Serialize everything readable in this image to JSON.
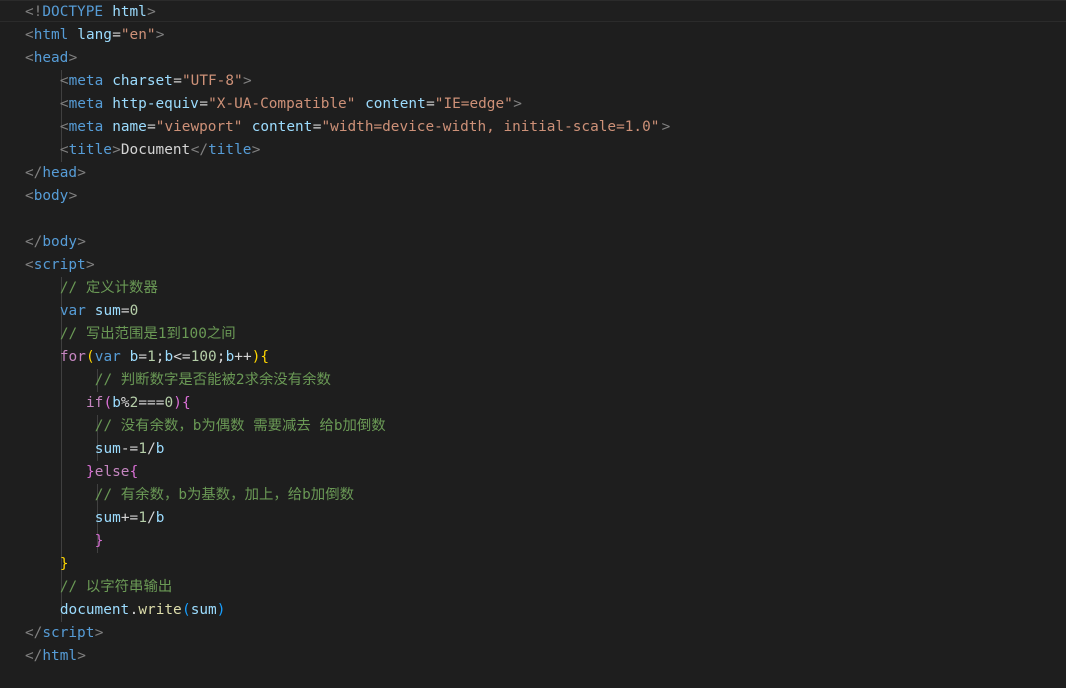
{
  "editor": {
    "language": "html",
    "theme": "dark",
    "lines": [
      [
        [
          "<!",
          "punc"
        ],
        [
          "DOCTYPE",
          "tag"
        ],
        [
          " ",
          "plain"
        ],
        [
          "html",
          "attr"
        ],
        [
          ">",
          "punc"
        ]
      ],
      [
        [
          "<",
          "punc"
        ],
        [
          "html",
          "tag"
        ],
        [
          " ",
          "plain"
        ],
        [
          "lang",
          "attr"
        ],
        [
          "=",
          "plain"
        ],
        [
          "\"en\"",
          "str"
        ],
        [
          ">",
          "punc"
        ]
      ],
      [
        [
          "<",
          "punc"
        ],
        [
          "head",
          "tag"
        ],
        [
          ">",
          "punc"
        ]
      ],
      [
        [
          "    ",
          "plain"
        ],
        [
          "<",
          "punc"
        ],
        [
          "meta",
          "tag"
        ],
        [
          " ",
          "plain"
        ],
        [
          "charset",
          "attr"
        ],
        [
          "=",
          "plain"
        ],
        [
          "\"UTF-8\"",
          "str"
        ],
        [
          ">",
          "punc"
        ]
      ],
      [
        [
          "    ",
          "plain"
        ],
        [
          "<",
          "punc"
        ],
        [
          "meta",
          "tag"
        ],
        [
          " ",
          "plain"
        ],
        [
          "http-equiv",
          "attr"
        ],
        [
          "=",
          "plain"
        ],
        [
          "\"X-UA-Compatible\"",
          "str"
        ],
        [
          " ",
          "plain"
        ],
        [
          "content",
          "attr"
        ],
        [
          "=",
          "plain"
        ],
        [
          "\"IE=edge\"",
          "str"
        ],
        [
          ">",
          "punc"
        ]
      ],
      [
        [
          "    ",
          "plain"
        ],
        [
          "<",
          "punc"
        ],
        [
          "meta",
          "tag"
        ],
        [
          " ",
          "plain"
        ],
        [
          "name",
          "attr"
        ],
        [
          "=",
          "plain"
        ],
        [
          "\"viewport\"",
          "str"
        ],
        [
          " ",
          "plain"
        ],
        [
          "content",
          "attr"
        ],
        [
          "=",
          "plain"
        ],
        [
          "\"width=device-width, initial-scale=1.0\"",
          "str"
        ],
        [
          ">",
          "punc"
        ]
      ],
      [
        [
          "    ",
          "plain"
        ],
        [
          "<",
          "punc"
        ],
        [
          "title",
          "tag"
        ],
        [
          ">",
          "punc"
        ],
        [
          "Document",
          "plain"
        ],
        [
          "</",
          "punc"
        ],
        [
          "title",
          "tag"
        ],
        [
          ">",
          "punc"
        ]
      ],
      [
        [
          "</",
          "punc"
        ],
        [
          "head",
          "tag"
        ],
        [
          ">",
          "punc"
        ]
      ],
      [
        [
          "<",
          "punc"
        ],
        [
          "body",
          "tag"
        ],
        [
          ">",
          "punc"
        ]
      ],
      [],
      [
        [
          "</",
          "punc"
        ],
        [
          "body",
          "tag"
        ],
        [
          ">",
          "punc"
        ]
      ],
      [
        [
          "<",
          "punc"
        ],
        [
          "script",
          "tag"
        ],
        [
          ">",
          "punc"
        ]
      ],
      [
        [
          "    ",
          "plain"
        ],
        [
          "// 定义计数器",
          "cmt"
        ]
      ],
      [
        [
          "    ",
          "plain"
        ],
        [
          "var",
          "decl"
        ],
        [
          " ",
          "plain"
        ],
        [
          "sum",
          "var"
        ],
        [
          "=",
          "op"
        ],
        [
          "0",
          "num"
        ]
      ],
      [
        [
          "    ",
          "plain"
        ],
        [
          "// 写出范围是1到100之间",
          "cmt"
        ]
      ],
      [
        [
          "    ",
          "plain"
        ],
        [
          "for",
          "kw"
        ],
        [
          "(",
          "b1"
        ],
        [
          "var",
          "decl"
        ],
        [
          " ",
          "plain"
        ],
        [
          "b",
          "var"
        ],
        [
          "=",
          "op"
        ],
        [
          "1",
          "num"
        ],
        [
          ";",
          "plain"
        ],
        [
          "b",
          "var"
        ],
        [
          "<=",
          "op"
        ],
        [
          "100",
          "num"
        ],
        [
          ";",
          "plain"
        ],
        [
          "b",
          "var"
        ],
        [
          "++",
          "op"
        ],
        [
          ")",
          "b1"
        ],
        [
          "{",
          "b1"
        ]
      ],
      [
        [
          "        ",
          "plain"
        ],
        [
          "// 判断数字是否能被2求余没有余数",
          "cmt"
        ]
      ],
      [
        [
          "       ",
          "plain"
        ],
        [
          "if",
          "kw"
        ],
        [
          "(",
          "b2"
        ],
        [
          "b",
          "var"
        ],
        [
          "%",
          "op"
        ],
        [
          "2",
          "num"
        ],
        [
          "===",
          "op"
        ],
        [
          "0",
          "num"
        ],
        [
          ")",
          "b2"
        ],
        [
          "{",
          "b2"
        ]
      ],
      [
        [
          "        ",
          "plain"
        ],
        [
          "// 没有余数，b为偶数 需要减去 给b加倒数",
          "cmt"
        ]
      ],
      [
        [
          "        ",
          "plain"
        ],
        [
          "sum",
          "var"
        ],
        [
          "-=",
          "op"
        ],
        [
          "1",
          "num"
        ],
        [
          "/",
          "op"
        ],
        [
          "b",
          "var"
        ]
      ],
      [
        [
          "       ",
          "plain"
        ],
        [
          "}",
          "b2"
        ],
        [
          "else",
          "kw"
        ],
        [
          "{",
          "b2"
        ]
      ],
      [
        [
          "        ",
          "plain"
        ],
        [
          "// 有余数，b为基数，加上，给b加倒数",
          "cmt"
        ]
      ],
      [
        [
          "        ",
          "plain"
        ],
        [
          "sum",
          "var"
        ],
        [
          "+=",
          "op"
        ],
        [
          "1",
          "num"
        ],
        [
          "/",
          "op"
        ],
        [
          "b",
          "var"
        ]
      ],
      [
        [
          "        ",
          "plain"
        ],
        [
          "}",
          "b2"
        ]
      ],
      [
        [
          "    ",
          "plain"
        ],
        [
          "}",
          "b1"
        ]
      ],
      [
        [
          "    ",
          "plain"
        ],
        [
          "// 以字符串输出",
          "cmt"
        ]
      ],
      [
        [
          "    ",
          "plain"
        ],
        [
          "document",
          "var"
        ],
        [
          ".",
          "plain"
        ],
        [
          "write",
          "fn"
        ],
        [
          "(",
          "b3"
        ],
        [
          "sum",
          "var"
        ],
        [
          ")",
          "b3"
        ]
      ],
      [
        [
          "</",
          "punc"
        ],
        [
          "script",
          "tag"
        ],
        [
          ">",
          "punc"
        ]
      ],
      [
        [
          "</",
          "punc"
        ],
        [
          "html",
          "tag"
        ],
        [
          ">",
          "punc"
        ]
      ]
    ]
  }
}
